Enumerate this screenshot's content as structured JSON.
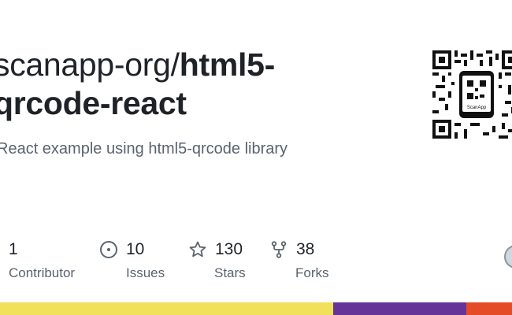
{
  "repo": {
    "owner_text": "scanapp-org/",
    "name_line1": "html5-",
    "name_line2": "qrcode-react",
    "description": "React example using html5-qrcode library"
  },
  "avatar": {
    "icon": "qr-code-logo",
    "logo_text": "ScanApp"
  },
  "stats": {
    "contributors": {
      "value": "1",
      "label": "Contributor",
      "icon": "contributor-avatar-icon"
    },
    "issues": {
      "value": "10",
      "label": "Issues",
      "icon": "issue-opened-icon"
    },
    "stars": {
      "value": "130",
      "label": "Stars",
      "icon": "star-icon"
    },
    "forks": {
      "value": "38",
      "label": "Forks",
      "icon": "repo-forked-icon"
    }
  },
  "languages": [
    {
      "color": "#f1e05a",
      "share": 0.65
    },
    {
      "color": "#663399",
      "share": 0.26
    },
    {
      "color": "#e34c26",
      "share": 0.09
    }
  ]
}
